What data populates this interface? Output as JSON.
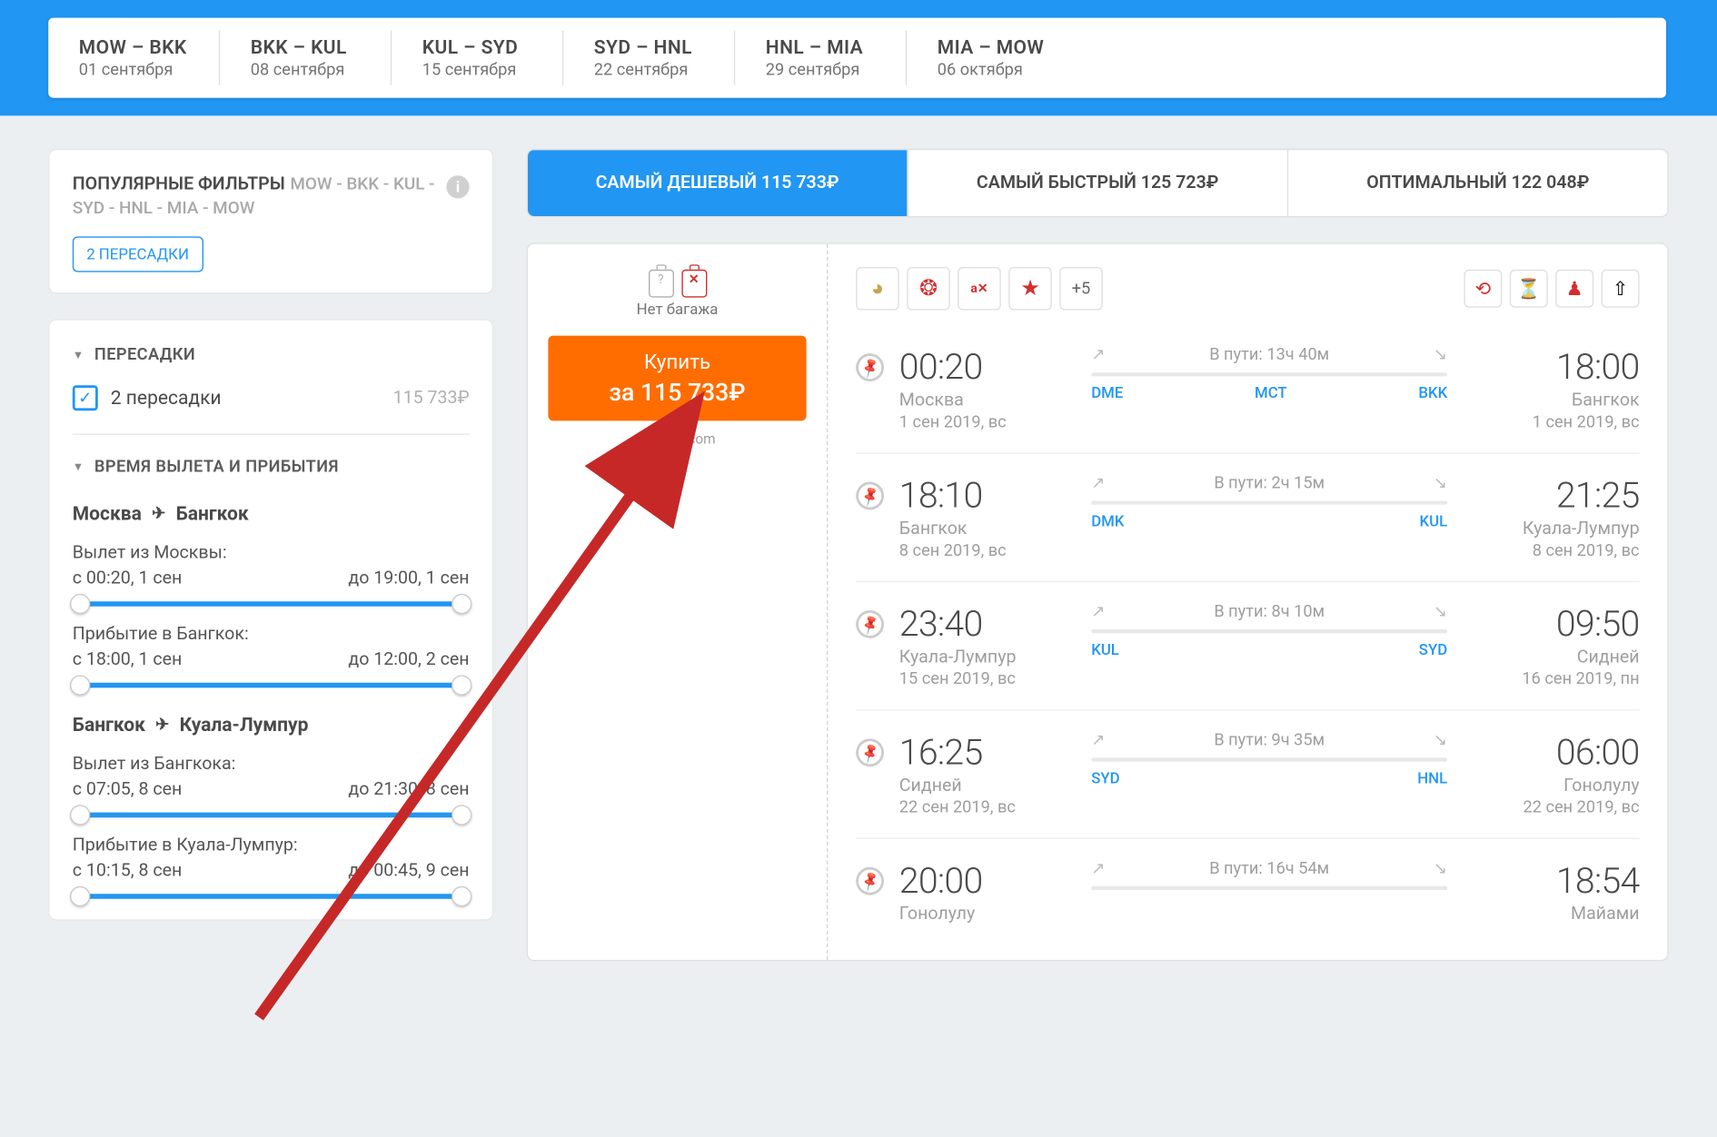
{
  "header_segments": [
    {
      "codes": "MOW – BKK",
      "date": "01 сентября"
    },
    {
      "codes": "BKK – KUL",
      "date": "08 сентября"
    },
    {
      "codes": "KUL – SYD",
      "date": "15 сентября"
    },
    {
      "codes": "SYD – HNL",
      "date": "22 сентября"
    },
    {
      "codes": "HNL – MIA",
      "date": "29 сентября"
    },
    {
      "codes": "MIA – MOW",
      "date": "06 октября"
    }
  ],
  "sidebar": {
    "popular_title": "ПОПУЛЯРНЫЕ ФИЛЬТРЫ",
    "popular_route": "MOW - BKK - KUL - SYD - HNL - MIA - MOW",
    "chip": "2 ПЕРЕСАДКИ",
    "transfers_title": "ПЕРЕСАДКИ",
    "transfers_option": "2 пересадки",
    "transfers_price": "115 733₽",
    "times_title": "ВРЕМЯ ВЫЛЕТА И ПРИБЫТИЯ",
    "route1": {
      "from": "Москва",
      "to": "Бангкок",
      "dep_label": "Вылет из Москвы:",
      "dep_from": "с 00:20, 1 сен",
      "dep_to": "до 19:00, 1 сен",
      "arr_label": "Прибытие в Бангкок:",
      "arr_from": "с 18:00, 1 сен",
      "arr_to": "до 12:00, 2 сен"
    },
    "route2": {
      "from": "Бангкок",
      "to": "Куала-Лумпур",
      "dep_label": "Вылет из Бангкока:",
      "dep_from": "с 07:05, 8 сен",
      "dep_to": "до 21:30, 8 сен",
      "arr_label": "Прибытие в Куала-Лумпур:",
      "arr_from": "с 10:15, 8 сен",
      "arr_to": "до 00:45, 9 сен"
    }
  },
  "tabs": {
    "cheapest": "САМЫЙ ДЕШЕВЫЙ  115 733₽",
    "fastest": "САМЫЙ БЫСТРЫЙ  125 723₽",
    "optimal": "ОПТИМАЛЬНЫЙ  122 048₽"
  },
  "ticket": {
    "no_baggage": "Нет багажа",
    "buy_label": "Купить",
    "buy_price": "за 115 733₽",
    "via": "на Kiwi.com",
    "plus_more": "+5",
    "segments": [
      {
        "dep_time": "00:20",
        "dep_city": "Москва",
        "dep_date": "1 сен 2019, вс",
        "duration": "В пути: 13ч 40м",
        "dep_code": "DME",
        "mid_code": "MCT",
        "arr_code": "BKK",
        "arr_time": "18:00",
        "arr_city": "Бангкок",
        "arr_date": "1 сен 2019, вс"
      },
      {
        "dep_time": "18:10",
        "dep_city": "Бангкок",
        "dep_date": "8 сен 2019, вс",
        "duration": "В пути: 2ч 15м",
        "dep_code": "DMK",
        "mid_code": "",
        "arr_code": "KUL",
        "arr_time": "21:25",
        "arr_city": "Куала-Лумпур",
        "arr_date": "8 сен 2019, вс"
      },
      {
        "dep_time": "23:40",
        "dep_city": "Куала-Лумпур",
        "dep_date": "15 сен 2019, вс",
        "duration": "В пути: 8ч 10м",
        "dep_code": "KUL",
        "mid_code": "",
        "arr_code": "SYD",
        "arr_time": "09:50",
        "arr_city": "Сидней",
        "arr_date": "16 сен 2019, пн"
      },
      {
        "dep_time": "16:25",
        "dep_city": "Сидней",
        "dep_date": "22 сен 2019, вс",
        "duration": "В пути: 9ч 35м",
        "dep_code": "SYD",
        "mid_code": "",
        "arr_code": "HNL",
        "arr_time": "06:00",
        "arr_city": "Гонолулу",
        "arr_date": "22 сен 2019, вс"
      },
      {
        "dep_time": "20:00",
        "dep_city": "Гонолулу",
        "dep_date": "",
        "duration": "В пути: 16ч 54м",
        "dep_code": "",
        "mid_code": "",
        "arr_code": "",
        "arr_time": "18:54",
        "arr_city": "Майами",
        "arr_date": ""
      }
    ]
  }
}
